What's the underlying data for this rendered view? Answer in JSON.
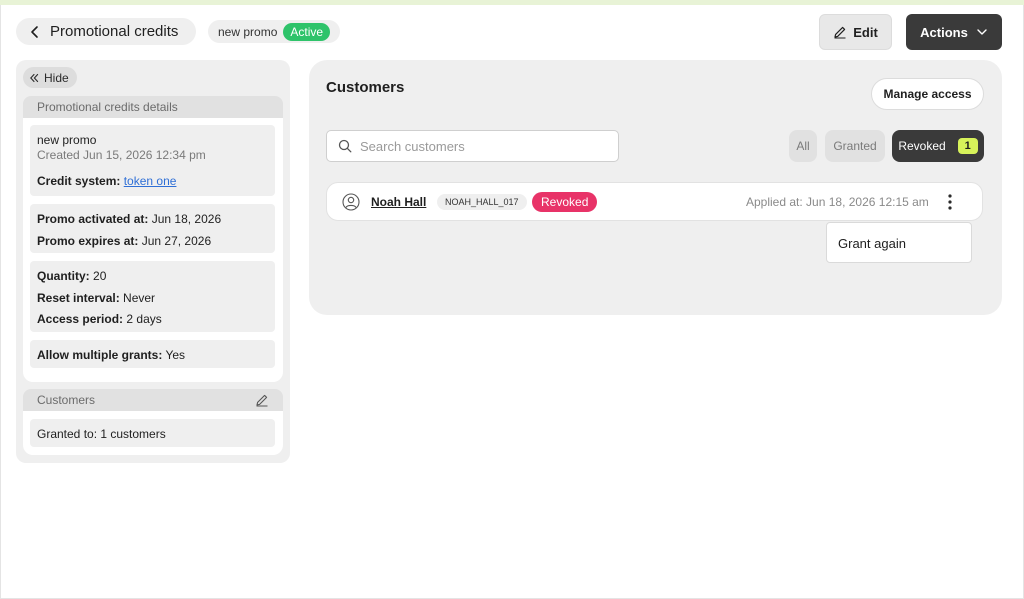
{
  "header": {
    "title": "Promotional credits",
    "promo_name": "new promo",
    "status": "Active",
    "edit_label": "Edit",
    "actions_label": "Actions"
  },
  "sidebar": {
    "hide_label": "Hide",
    "details_title": "Promotional credits details",
    "promo_name": "new promo",
    "created": "Created Jun 15, 2026 12:34 pm",
    "credit_system_label": "Credit system:",
    "credit_system_value": "token one",
    "activated_label": "Promo activated at:",
    "activated_value": "Jun 18, 2026",
    "expires_label": "Promo expires at:",
    "expires_value": "Jun 27, 2026",
    "quantity_label": "Quantity:",
    "quantity_value": "20",
    "reset_label": "Reset interval:",
    "reset_value": "Never",
    "access_label": "Access period:",
    "access_value": "2 days",
    "multiple_label": "Allow multiple grants:",
    "multiple_value": "Yes",
    "customers_title": "Customers",
    "granted_to": "Granted to: 1 customers"
  },
  "main": {
    "title": "Customers",
    "manage_label": "Manage access",
    "search_placeholder": "Search customers",
    "filters": {
      "all": "All",
      "granted": "Granted",
      "revoked": "Revoked",
      "revoked_count": "1"
    },
    "customers": [
      {
        "name": "Noah Hall",
        "code": "NOAH_HALL_017",
        "status": "Revoked",
        "applied": "Applied at: Jun 18, 2026 12:15 am"
      }
    ],
    "menu": {
      "grant_again": "Grant again"
    }
  },
  "colors": {
    "active": "#2ec36a",
    "revoked": "#e83368",
    "count_badge": "#d7f25a",
    "dark_button": "#3a3a3a"
  }
}
